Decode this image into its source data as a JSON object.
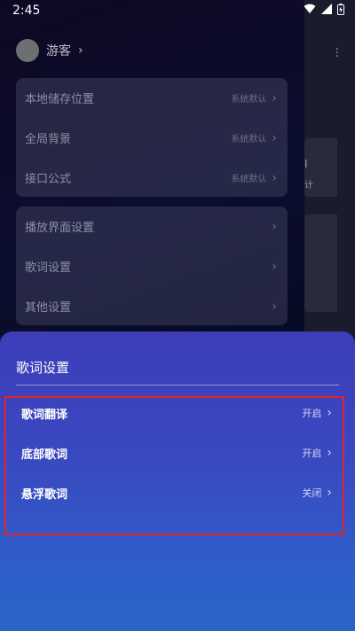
{
  "status_bar": {
    "time": "2:45"
  },
  "user": {
    "name": "游客",
    "chevron": "›"
  },
  "settings_group1": [
    {
      "label": "本地储存位置",
      "value": "系统默认"
    },
    {
      "label": "全局背景",
      "value": "系统默认"
    },
    {
      "label": "接口公式",
      "value": "系统默认"
    }
  ],
  "settings_group2": [
    {
      "label": "播放界面设置"
    },
    {
      "label": "歌词设置"
    },
    {
      "label": "其他设置"
    }
  ],
  "right_panel": {
    "text1": "I",
    "text2": "计"
  },
  "sheet": {
    "title": "歌词设置",
    "items": [
      {
        "label": "歌词翻译",
        "value": "开启"
      },
      {
        "label": "底部歌词",
        "value": "开启"
      },
      {
        "label": "悬浮歌词",
        "value": "关闭"
      }
    ]
  },
  "colors": {
    "highlight": "#e0242b",
    "sheet_top": "#3d3db8",
    "sheet_bottom": "#2a66c8"
  },
  "icons": [
    "wifi-icon",
    "signal-icon",
    "battery-icon",
    "chevron-right-icon",
    "more-vert-icon"
  ]
}
